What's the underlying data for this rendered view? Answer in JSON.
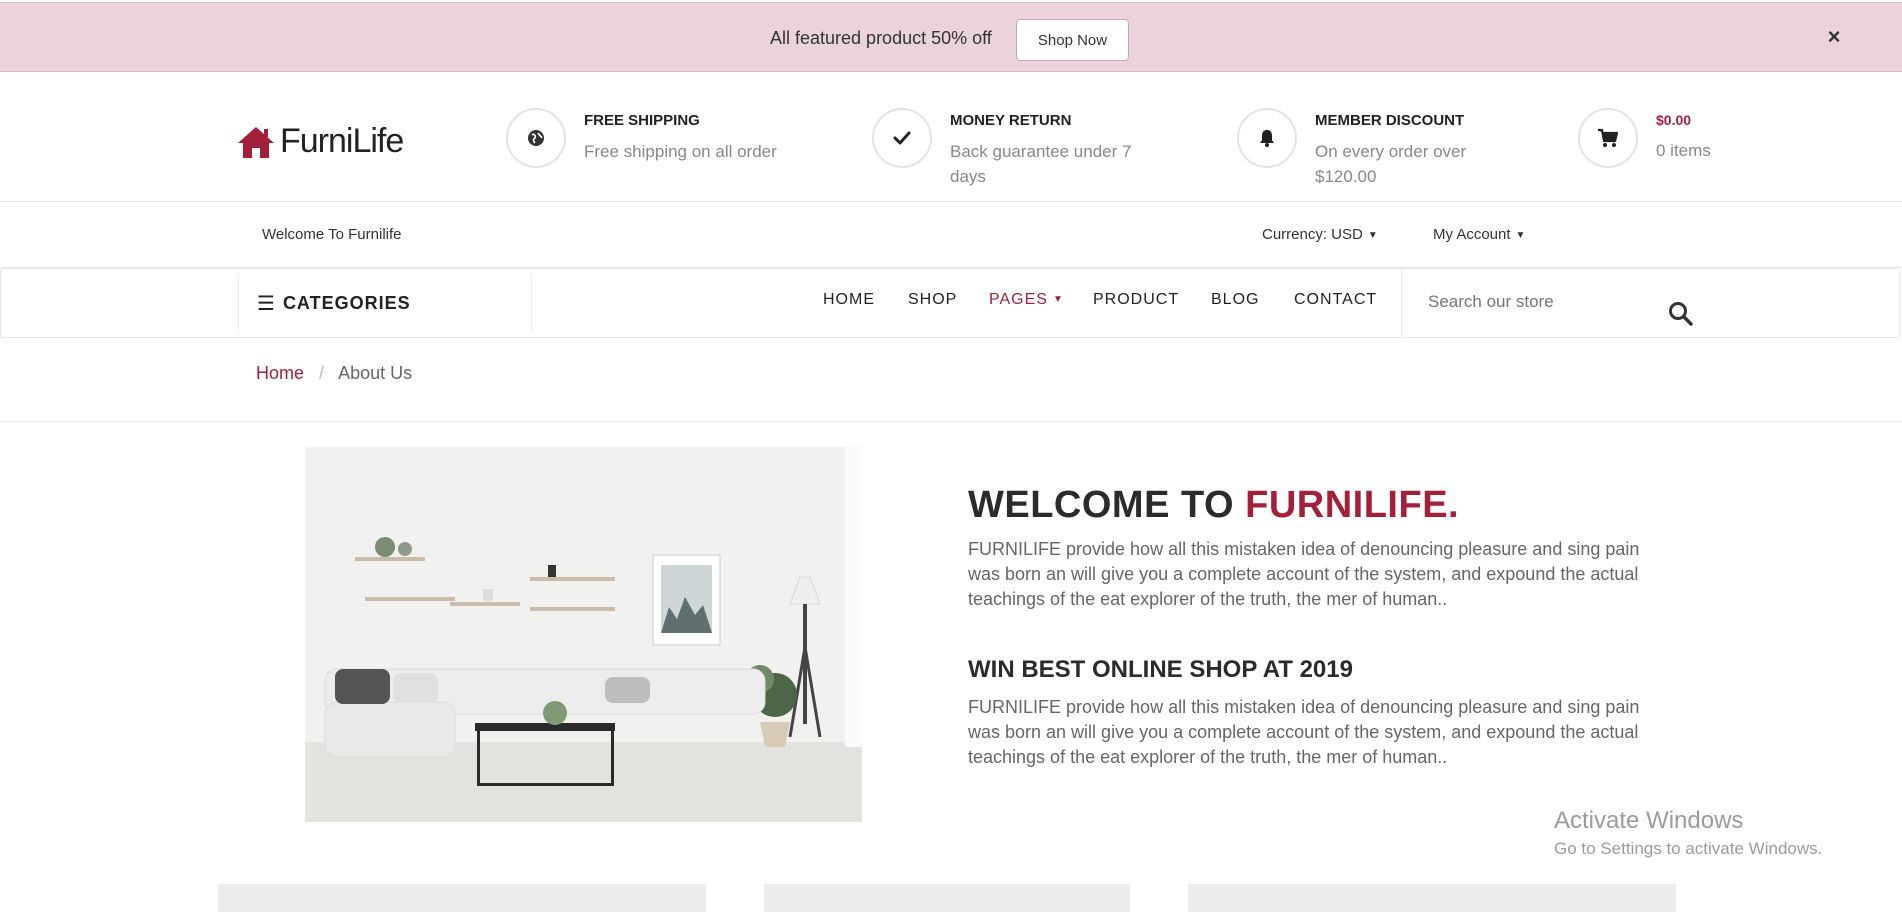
{
  "promo": {
    "text": "All featured product 50% off",
    "button": "Shop Now",
    "close": "×"
  },
  "brand": {
    "name": "FurniLife",
    "accent": "#a4203a"
  },
  "features": [
    {
      "icon": "globe-icon",
      "title": "FREE SHIPPING",
      "sub": "Free shipping on all order"
    },
    {
      "icon": "check-icon",
      "title": "MONEY RETURN",
      "sub": "Back guarantee under 7 days"
    },
    {
      "icon": "bell-icon",
      "title": "MEMBER DISCOUNT",
      "sub": "On every order over $120.00"
    }
  ],
  "cart": {
    "price": "$0.00",
    "items": "0 items"
  },
  "topbar": {
    "welcome": "Welcome To Furnilife",
    "currency": "Currency: USD",
    "account": "My Account"
  },
  "nav": {
    "categories": "CATEGORIES",
    "items": [
      "HOME",
      "SHOP",
      "PAGES",
      "PRODUCT",
      "BLOG",
      "CONTACT"
    ],
    "active": "PAGES",
    "search_placeholder": "Search our store"
  },
  "breadcrumb": {
    "home": "Home",
    "sep": "/",
    "current": "About Us"
  },
  "about": {
    "heading_prefix": "WELCOME TO ",
    "heading_accent": "FURNILIFE.",
    "paragraph1": "FURNILIFE provide how all this mistaken idea of denouncing pleasure and sing pain was born an will give you a complete account of the system, and expound the actual teachings of the eat explorer of the truth, the mer of human..",
    "subheading": "WIN BEST ONLINE SHOP AT 2019",
    "paragraph2": "FURNILIFE provide how all this mistaken idea of denouncing pleasure and sing pain was born an will give you a complete account of the system, and expound the actual teachings of the eat explorer of the truth, the mer of human.."
  },
  "watermark": {
    "title": "Activate Windows",
    "sub": "Go to Settings to activate Windows."
  }
}
